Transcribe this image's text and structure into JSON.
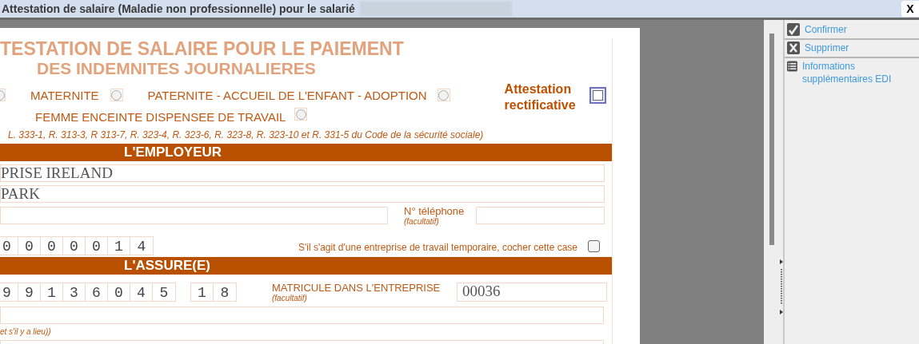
{
  "window": {
    "title": "Attestation de salaire (Maladie non professionnelle) pour le salarié",
    "close": "X"
  },
  "form": {
    "title_lines": [
      "TESTATION DE SALAIRE POUR LE PAIEMENT",
      "DES INDEMNITES JOURNALIERES"
    ],
    "leading_radio": {
      "selected": false
    },
    "options": [
      {
        "label": "MATERNITE",
        "selected": false
      },
      {
        "label": "PATERNITE - ACCUEIL DE L'ENFANT - ADOPTION",
        "selected": false
      },
      {
        "label": "FEMME ENCEINTE DISPENSEE DE TRAVAIL",
        "selected": false
      }
    ],
    "rectificative": {
      "label": "Attestation rectificative",
      "checked": false
    },
    "legal_reference": "L. 333-1, R. 313-3, R 313-7, R. 323-4, R. 323-6, R. 323-8, R. 323-10 et R. 331-5 du Code de la  sécurité sociale)"
  },
  "employer": {
    "header": "L'EMPLOYEUR",
    "name": "PRISE IRELAND",
    "address": "PARK",
    "phone_label": "N° téléphone",
    "phone_hint": "(facultatif)",
    "number_digits": [
      "0",
      "0",
      "0",
      "0",
      "0",
      "1",
      "4"
    ],
    "temp_agency": {
      "label": "S'il s'agit d'une entreprise de travail temporaire, cocher cette case",
      "checked": false
    }
  },
  "insured": {
    "header": "L'ASSURE(E)",
    "number_digits": [
      "9",
      "9",
      "1",
      "3",
      "6",
      "0",
      "4",
      "5"
    ],
    "key_digits": [
      "1",
      "8"
    ],
    "matricule_label": "MATRICULE DANS L'ENTREPRISE",
    "matricule_hint": "(facultatif)",
    "matricule": "00036",
    "note": "et s'il y a lieu))"
  },
  "actions": [
    {
      "kind": "confirm",
      "label": "Confirmer"
    },
    {
      "kind": "delete",
      "label": "Supprimer"
    },
    {
      "kind": "list",
      "label": "Informations supplémentaires EDI"
    }
  ]
}
